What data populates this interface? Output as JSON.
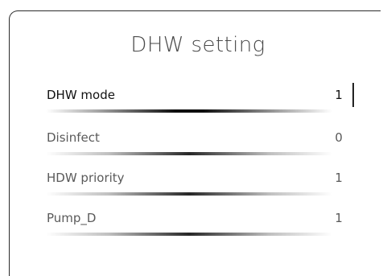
{
  "screen": {
    "title": "DHW setting"
  },
  "settings": [
    {
      "label": "DHW mode",
      "value": "1",
      "selected": true
    },
    {
      "label": "Disinfect",
      "value": "0",
      "selected": false
    },
    {
      "label": "HDW priority",
      "value": "1",
      "selected": false
    },
    {
      "label": "Pump_D",
      "value": "1",
      "selected": false
    }
  ],
  "colors": {
    "panel_border": "#2b2b2b",
    "title_text": "#4a4a4a",
    "selected_text": "#111111",
    "normal_text": "#5a5a5a",
    "background": "#ffffff"
  }
}
